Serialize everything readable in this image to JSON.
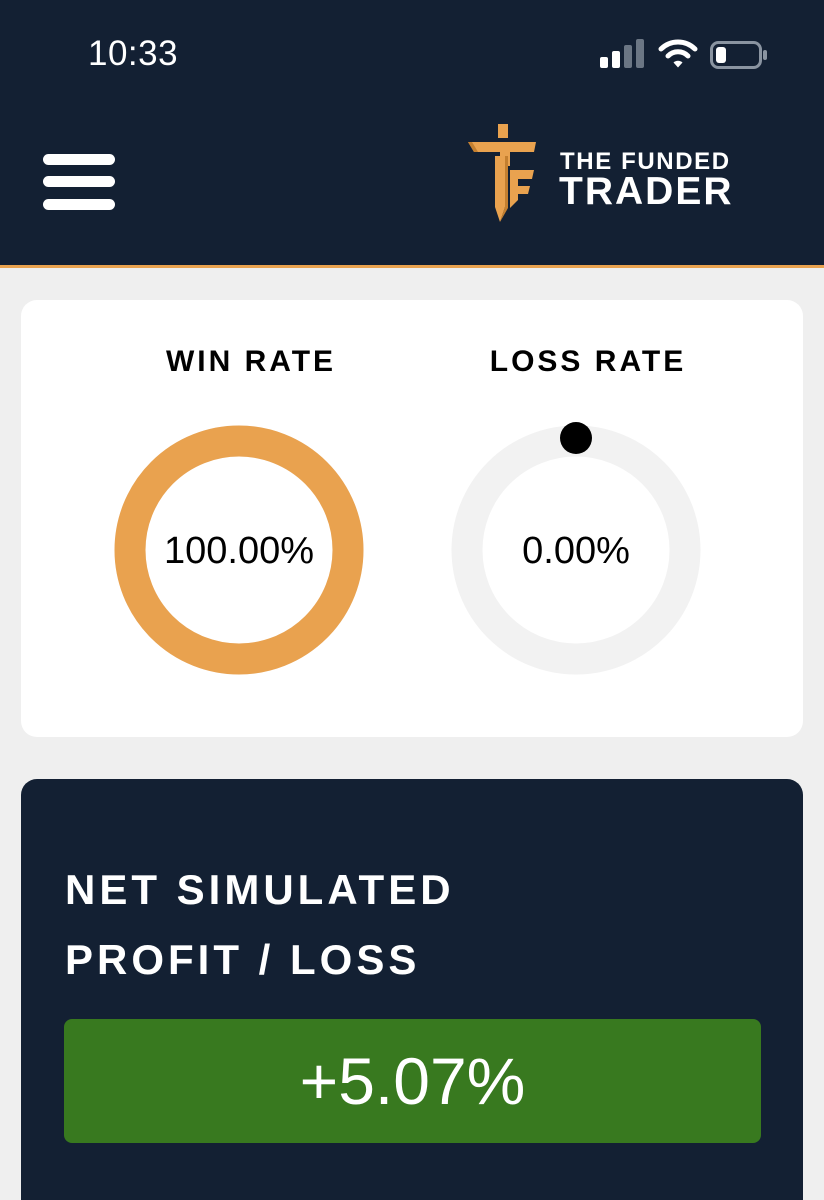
{
  "status_bar": {
    "time": "10:33",
    "icons": [
      "signal-icon",
      "wifi-icon",
      "battery-icon"
    ]
  },
  "header": {
    "menu_icon": "hamburger-menu-icon",
    "logo": {
      "line1": "THE FUNDED",
      "line2": "TRADER"
    }
  },
  "rates": {
    "win": {
      "label": "WIN RATE",
      "value": "100.00%",
      "fraction": 1.0
    },
    "loss": {
      "label": "LOSS RATE",
      "value": "0.00%",
      "fraction": 0.0
    }
  },
  "profit_loss": {
    "title_line1": "NET SIMULATED",
    "title_line2": "PROFIT / LOSS",
    "value": "+5.07%"
  },
  "colors": {
    "navy": "#132033",
    "accent_orange": "#e9a24f",
    "track_gray": "#f2f2f2",
    "profit_green": "#38791f"
  }
}
